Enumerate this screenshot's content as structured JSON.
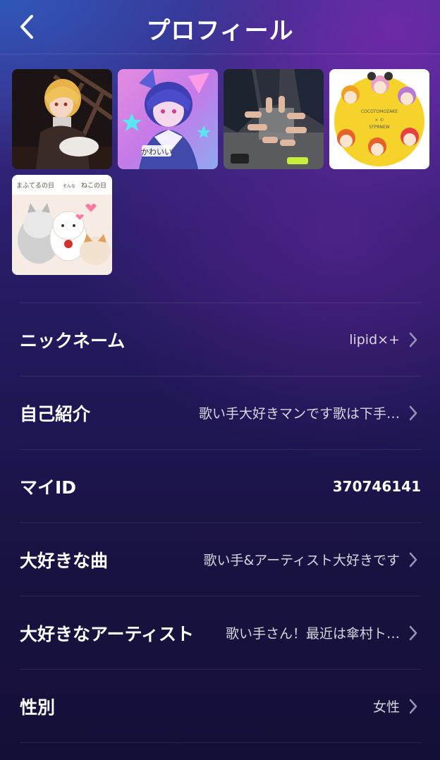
{
  "header": {
    "title": "プロフィール",
    "back_icon": "chevron-left-icon"
  },
  "photos": [
    {
      "name": "photo-1",
      "alt": "anime-character-blonde"
    },
    {
      "name": "photo-2",
      "alt": "anime-character-blue-hair"
    },
    {
      "name": "photo-3",
      "alt": "group-hands-photo"
    },
    {
      "name": "photo-4",
      "alt": "chibi-characters-yellow"
    },
    {
      "name": "photo-5",
      "alt": "cats-illustration"
    }
  ],
  "profile": {
    "nickname": {
      "label": "ニックネーム",
      "value": "lipid×+"
    },
    "bio": {
      "label": "自己紹介",
      "value": "歌い手大好きマンです歌は下手…"
    },
    "my_id": {
      "label": "マイID",
      "value": "370746141"
    },
    "favorite_song": {
      "label": "大好きな曲",
      "value": "歌い手&アーティスト大好きです"
    },
    "favorite_artist": {
      "label": "大好きなアーティスト",
      "value": "歌い手さん！最近は傘村ト…"
    },
    "gender": {
      "label": "性別",
      "value": "女性"
    }
  },
  "photo4_text": {
    "line1": "COCOTOMOZAKE",
    "line2": "× ©",
    "line3": "STPRNEW"
  },
  "photo5_text": {
    "left": "まふてるの日",
    "middle": "そんな",
    "right": "ねこの日"
  },
  "photo2_text": "かわいい",
  "colors": {
    "chevron": "#9a93b8",
    "divider": "rgba(255,255,255,0.10)"
  }
}
